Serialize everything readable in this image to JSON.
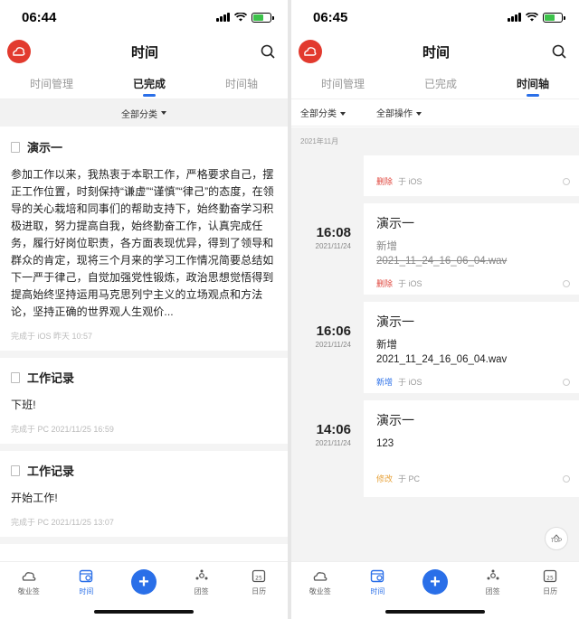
{
  "left": {
    "status": {
      "time": "06:44"
    },
    "nav": {
      "title": "时间"
    },
    "tabs": [
      "时间管理",
      "已完成",
      "时间轴"
    ],
    "active_tab": 1,
    "filter": {
      "category": "全部分类"
    },
    "cards": [
      {
        "title": "演示一",
        "body": "参加工作以来，我热衷于本职工作，严格要求自己，摆正工作位置，时刻保持“谦虚”“谨慎”“律己”的态度，在领导的关心栽培和同事们的帮助支持下，始终勤奋学习积极进取，努力提高自我，始终勤奋工作，认真完成任务，履行好岗位职责，各方面表现优异，得到了领导和群众的肯定，现将三个月来的学习工作情况简要总结如下一严于律己，自觉加强党性锻炼，政治思想觉悟得到提高始终坚持运用马克思列宁主义的立场观点和方法论，坚持正确的世界观人生观价...",
        "meta": "完成于  iOS  昨天 10:57"
      },
      {
        "title": "工作记录",
        "body": "下班!",
        "meta": "完成于  PC  2021/11/25 16:59"
      },
      {
        "title": "工作记录",
        "body": "开始工作!",
        "meta": "完成于  PC  2021/11/25 13:07"
      }
    ],
    "bottom": [
      {
        "label": "敬业签",
        "icon": "cloud-icon"
      },
      {
        "label": "时间",
        "icon": "calendar-icon"
      },
      {
        "label": "",
        "icon": "plus-icon"
      },
      {
        "label": "团签",
        "icon": "group-icon"
      },
      {
        "label": "日历",
        "icon": "date-icon"
      }
    ]
  },
  "right": {
    "status": {
      "time": "06:45"
    },
    "nav": {
      "title": "时间"
    },
    "tabs": [
      "时间管理",
      "已完成",
      "时间轴"
    ],
    "active_tab": 2,
    "filter": {
      "category": "全部分类",
      "operation": "全部操作"
    },
    "month": "2021年11月",
    "items": [
      {
        "clock": "",
        "day": "",
        "title": "",
        "lines": [],
        "op": "删除",
        "op_type": "del",
        "src": "于 iOS"
      },
      {
        "clock": "16:08",
        "day": "2021/11/24",
        "title": "演示一",
        "lines": [
          "新增",
          "2021_11_24_16_06_04.wav"
        ],
        "line_style": "strike",
        "op": "删除",
        "op_type": "del",
        "src": "于 iOS"
      },
      {
        "clock": "16:06",
        "day": "2021/11/24",
        "title": "演示一",
        "lines": [
          "新增",
          "2021_11_24_16_06_04.wav"
        ],
        "line_style": "normal",
        "op": "新增",
        "op_type": "add",
        "src": "于 iOS"
      },
      {
        "clock": "14:06",
        "day": "2021/11/24",
        "title": "演示一",
        "lines": [
          "123"
        ],
        "line_style": "normal",
        "op": "修改",
        "op_type": "mod",
        "src": "于 PC"
      }
    ],
    "totop": "TOP",
    "bottom": [
      {
        "label": "敬业签",
        "icon": "cloud-icon"
      },
      {
        "label": "时间",
        "icon": "calendar-icon"
      },
      {
        "label": "",
        "icon": "plus-icon"
      },
      {
        "label": "团签",
        "icon": "group-icon"
      },
      {
        "label": "日历",
        "icon": "date-icon"
      }
    ]
  },
  "colors": {
    "accent": "#2a6fe8",
    "logo": "#e23a2e",
    "delete": "#e0473e",
    "modify": "#e7a23a"
  }
}
